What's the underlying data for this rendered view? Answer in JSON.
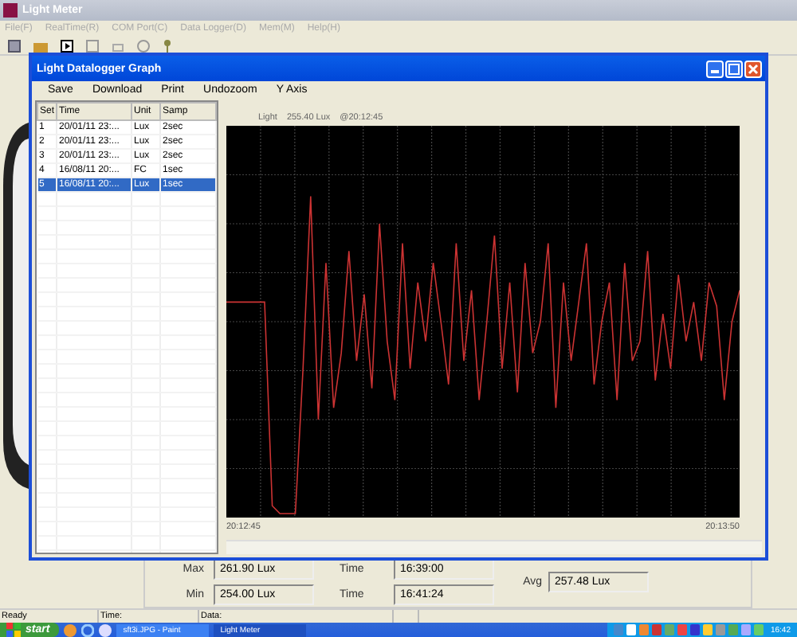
{
  "window": {
    "title": "Light Meter"
  },
  "menu": [
    "File(F)",
    "RealTime(R)",
    "COM Port(C)",
    "Data Logger(D)",
    "Mem(M)",
    "Help(H)"
  ],
  "graph_window": {
    "title": "Light Datalogger Graph",
    "menu": [
      "Save",
      "Download",
      "Print",
      "Undozoom",
      "Y Axis"
    ],
    "table": {
      "columns": [
        "Set",
        "Time",
        "Unit",
        "Samp"
      ],
      "rows": [
        {
          "cells": [
            "1",
            "20/01/11 23:...",
            "Lux",
            "2sec"
          ],
          "selected": false
        },
        {
          "cells": [
            "2",
            "20/01/11 23:...",
            "Lux",
            "2sec"
          ],
          "selected": false
        },
        {
          "cells": [
            "3",
            "20/01/11 23:...",
            "Lux",
            "2sec"
          ],
          "selected": false
        },
        {
          "cells": [
            "4",
            "16/08/11 20:...",
            "FC",
            "1sec"
          ],
          "selected": false
        },
        {
          "cells": [
            "5",
            "16/08/11 20:...",
            "Lux",
            "1sec"
          ],
          "selected": true
        }
      ]
    },
    "chart": {
      "series_label": "Light",
      "reading": "255.40 Lux",
      "time": "@20:12:45",
      "x_start": "20:12:45",
      "x_end": "20:13:50"
    }
  },
  "stats": [
    {
      "label": "Max",
      "value": "261.90  Lux",
      "time_label": "Time",
      "time": "16:39:00"
    },
    {
      "label": "Min",
      "value": "254.00  Lux",
      "time_label": "Time",
      "time": "16:41:24"
    }
  ],
  "avg": {
    "label": "Avg",
    "value": "257.48  Lux"
  },
  "status_bar": [
    "Ready",
    "Time:",
    "Data:"
  ],
  "taskbar": {
    "start": "start",
    "tasks": [
      {
        "label": "sft3i.JPG - Paint",
        "selected": false
      },
      {
        "label": "Light Meter",
        "selected": true
      }
    ],
    "clock": "16:42"
  }
}
